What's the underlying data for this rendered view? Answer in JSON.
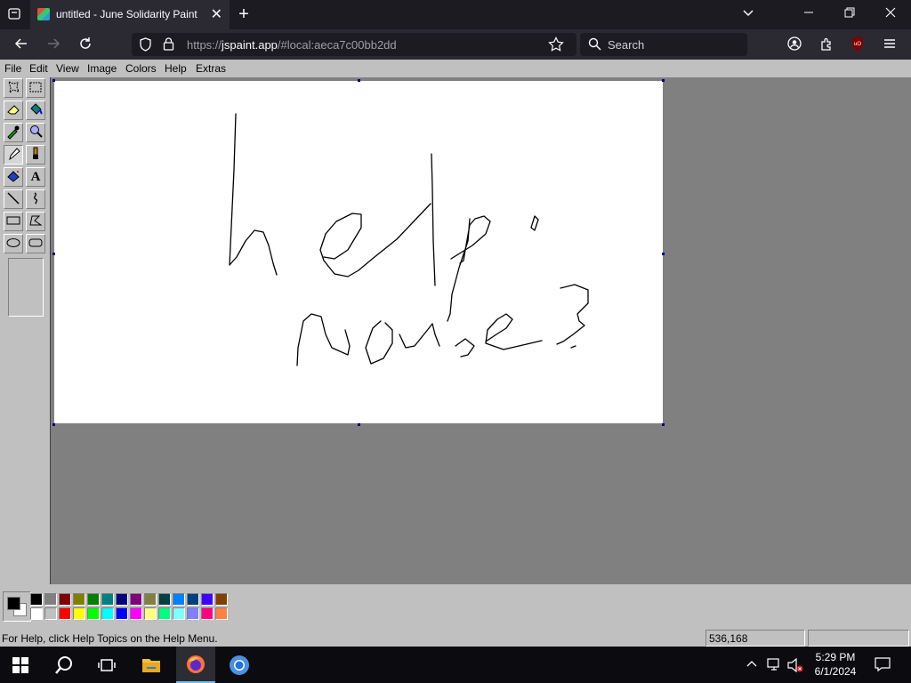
{
  "browser": {
    "tab_title": "untitled - June Solidarity Paint",
    "url_prefix": "https://",
    "url_domain": "jspaint.app",
    "url_rest": "/#local:aeca7c00bb2dd",
    "search_placeholder": "Search",
    "new_tab_symbol": "+",
    "tab_close_symbol": "✕",
    "icons": [
      "tab-list-icon",
      "back-icon",
      "forward-icon",
      "reload-icon",
      "shield-icon",
      "lock-icon",
      "bookmark-star-icon",
      "search-icon",
      "account-icon",
      "extensions-icon",
      "ublock-icon",
      "menu-icon",
      "chevron-down-icon",
      "minimize-icon",
      "restore-icon",
      "close-icon"
    ]
  },
  "menu": {
    "items": [
      "File",
      "Edit",
      "View",
      "Image",
      "Colors",
      "Help",
      "Extras"
    ]
  },
  "toolbox": {
    "tools": [
      "free-form-select",
      "select",
      "eraser",
      "fill-with-color",
      "pick-color",
      "magnifier",
      "pencil",
      "brush",
      "airbrush",
      "text",
      "line",
      "curve",
      "rectangle",
      "polygon",
      "ellipse",
      "rounded-rectangle"
    ],
    "selected_tool": "pencil",
    "text_tool_glyph": "A"
  },
  "palette": {
    "primary": "#000000",
    "secondary": "#ffffff",
    "row1": [
      "#000000",
      "#808080",
      "#800000",
      "#808000",
      "#008000",
      "#008080",
      "#000080",
      "#800080",
      "#808040",
      "#004040",
      "#0080ff",
      "#004080",
      "#4000ff",
      "#804000"
    ],
    "row2": [
      "#ffffff",
      "#c0c0c0",
      "#ff0000",
      "#ffff00",
      "#00ff00",
      "#00ffff",
      "#0000ff",
      "#ff00ff",
      "#ffff80",
      "#00ff80",
      "#80ffff",
      "#8080ff",
      "#ff0080",
      "#ff8040"
    ]
  },
  "status": {
    "help_text": "For Help, click Help Topics on the Help Menu.",
    "coordinates": "536,168",
    "selection_size": ""
  },
  "taskbar": {
    "time": "5:29 PM",
    "date": "6/1/2024",
    "apps": [
      "start",
      "search",
      "task-view",
      "file-explorer",
      "firefox",
      "chrome"
    ],
    "tray": [
      "show-hidden-icons",
      "network",
      "volume-muted",
      "notifications"
    ]
  },
  "drawing": {
    "description_text_in_strokes": [
      "help",
      "mouse?"
    ]
  }
}
